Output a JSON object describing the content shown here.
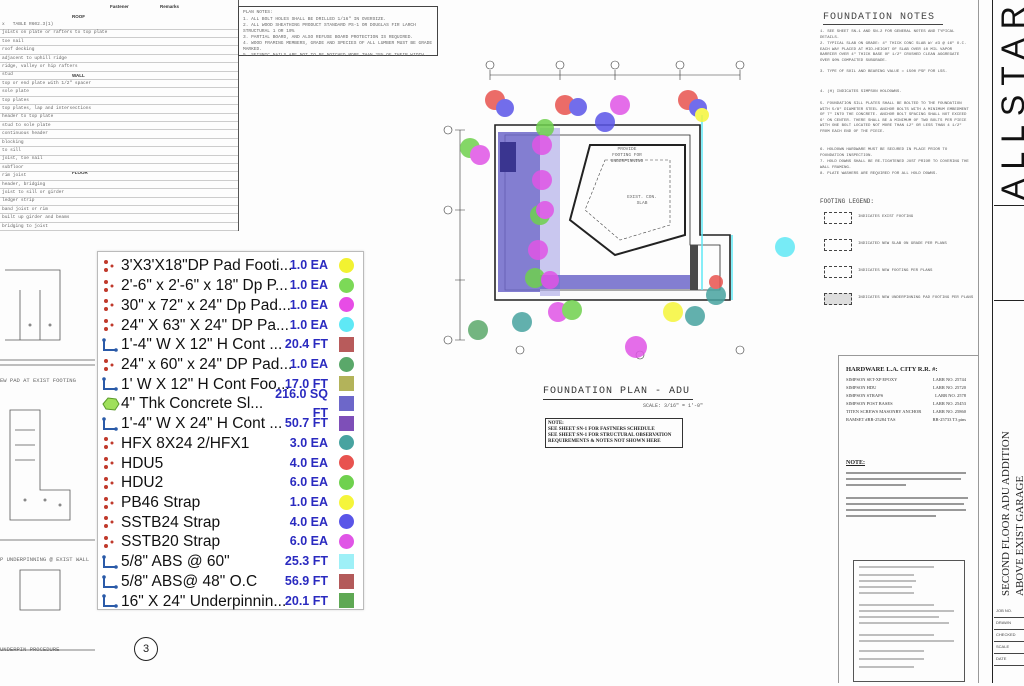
{
  "schedule": {
    "col_a": "Fastener",
    "col_b": "Remarks",
    "section_roof": "ROOF",
    "section_wall": "WALL",
    "section_floor": "FLOOR",
    "rows": [
      "x   TABLE R602.3(1)",
      "joists on plate or rafters to top plate",
      "toe nail",
      "roof decking",
      "adjacent to uphill ridge",
      "ridge, valley or hip rafters",
      "stud",
      "top or end plate with 1/2\" spacer",
      "sole plate",
      "top plates",
      "top plates, lap and intersections",
      "header to top plate",
      "stud to sole plate",
      "continuous header",
      "blocking",
      "to sill",
      "joist, toe nail",
      "subfloor",
      "rim joist",
      "header, bridging",
      "joist to sill or girder",
      "ledger strip",
      "band joist or rim",
      "built up girder and beams",
      "bridging to joist"
    ]
  },
  "plan_notes": {
    "title": "PLAN NOTES:",
    "lines": [
      "1. ALL BOLT HOLES SHALL BE DRILLED 1/16\" IN OVERSIZE.",
      "2. ALL WOOD SHEATHING PRODUCT STANDARD PS-1 OR DOUGLAS FIR LARCH STRUCTURAL 1 OR 10%",
      "3. PARTIAL BOARD, AND ALSO REFUSE BOARD PROTECTION IS REQUIRED.",
      "4. WOOD FRAMING MEMBERS, GRADE AND SPECIES OF ALL LUMBER MUST BE GRADE MARKED.",
      "5. SEISMIC NAILS ARE NOT TO BE NOTCHED MORE THAN 25% OF THEIR WIDTH."
    ]
  },
  "takeoff": {
    "items": [
      {
        "name": "3'X3'X18\"DP Pad Footi...",
        "qty": "1.0 EA",
        "icon": "count-dots-icon",
        "color": "#f2f231",
        "shape": "circle"
      },
      {
        "name": "2'-6\" x 2'-6\" x 18\" Dp P...",
        "qty": "1.0 EA",
        "icon": "count-dots-icon",
        "color": "#7cd957",
        "shape": "circle"
      },
      {
        "name": "30\" x 72\" x 24\" Dp Pad...",
        "qty": "1.0 EA",
        "icon": "count-dots-icon",
        "color": "#e74ce6",
        "shape": "circle"
      },
      {
        "name": "24\" X 63\" X 24\" DP Pa...",
        "qty": "1.0 EA",
        "icon": "count-dots-icon",
        "color": "#5fe8f5",
        "shape": "circle"
      },
      {
        "name": "1'-4\" W X 12\" H Cont ...",
        "qty": "20.4 FT",
        "icon": "linear-measure-icon",
        "color": "#b85b5b",
        "shape": "square"
      },
      {
        "name": "24\" x 60\" x 24\" DP Pad...",
        "qty": "1.0 EA",
        "icon": "count-dots-icon",
        "color": "#5aa86a",
        "shape": "circle"
      },
      {
        "name": "1' W X 12\" H Cont Foo...",
        "qty": "17.0 FT",
        "icon": "linear-measure-icon",
        "color": "#b3b35a",
        "shape": "square"
      },
      {
        "name": "4\" Thk Concrete Sl...",
        "qty": "216.0 SQ FT",
        "icon": "area-measure-icon",
        "color": "#6d67c9",
        "shape": "square"
      },
      {
        "name": "1'-4\" W X 24\" H Cont ...",
        "qty": "50.7 FT",
        "icon": "linear-measure-icon",
        "color": "#7e4fb8",
        "shape": "square"
      },
      {
        "name": "HFX 8X24 2/HFX1",
        "qty": "3.0 EA",
        "icon": "count-dots-icon",
        "color": "#48a3a0",
        "shape": "circle"
      },
      {
        "name": "HDU5",
        "qty": "4.0 EA",
        "icon": "count-dots-icon",
        "color": "#e8534f",
        "shape": "circle"
      },
      {
        "name": "HDU2",
        "qty": "6.0 EA",
        "icon": "count-dots-icon",
        "color": "#6fd14e",
        "shape": "circle"
      },
      {
        "name": "PB46 Strap",
        "qty": "1.0 EA",
        "icon": "count-dots-icon",
        "color": "#f5f53a",
        "shape": "circle"
      },
      {
        "name": "SSTB24 Strap",
        "qty": "4.0 EA",
        "icon": "count-dots-icon",
        "color": "#5a55e8",
        "shape": "circle"
      },
      {
        "name": "SSTB20 Strap",
        "qty": "6.0 EA",
        "icon": "count-dots-icon",
        "color": "#e055e6",
        "shape": "circle"
      },
      {
        "name": "5/8\" ABS @ 60\"",
        "qty": "25.3 FT",
        "icon": "linear-measure-icon",
        "color": "#9ef0f7",
        "shape": "square"
      },
      {
        "name": "5/8\" ABS@ 48\" O.C",
        "qty": "56.9 FT",
        "icon": "linear-measure-icon",
        "color": "#b35a5a",
        "shape": "square"
      },
      {
        "name": "16\" X 24\" Underpinnin...",
        "qty": "20.1 FT",
        "icon": "linear-measure-icon",
        "color": "#5fa854",
        "shape": "square"
      }
    ],
    "page_number": "3"
  },
  "left_details": {
    "label_pad": "EW PAD AT EXIST FOOTING",
    "label_underpin": "P UNDERPINNING @ EXIST WALL",
    "label_procedure": "UNDERPIN PROCEDURE"
  },
  "plan": {
    "title": "FOUNDATION PLAN - ADU",
    "scale": "SCALE: 3/16\" = 1'-0\"",
    "note_title": "NOTE:",
    "note_lines": [
      "SEE SHEET SN-1 FOR FASTNERS SCHEDULE",
      "SEE SHEET SN-1 FOR STRUCTURAL OBSERVATION",
      "REQUIREMENTS & NOTES NOT SHOWN HERE"
    ],
    "label_provide": "PROVIDE FOOTING FOR UNDERPINNING",
    "label_exist": "EXIST. CON. SLAB"
  },
  "foundation_notes": {
    "title": "FOUNDATION NOTES",
    "notes": [
      "1. SEE SHEET SN-1 AND SN-2 FOR GENERAL NOTES AND TYPICAL DETAILS.",
      "2. TYPICAL SLAB ON GRADE: 4\" THICK CONC SLAB W/ #3 @ 16\" O.C. EACH WAY PLACED AT MID-HEIGHT OF SLAB OVER 10 MIL VAPOR BARRIER OVER 4\" THICK BASE OF 1/2\" CRUSHED CLEAN AGGREGATE OVER 90% COMPACTED SUBGRADE.",
      "3. TYPE OF SOIL AND BEARING VALUE = 1500 PSF FOR LSS.",
      "4. (H) INDICATES SIMPSON HOLDOWNS.",
      "5. FOUNDATION SILL PLATES SHALL BE BOLTED TO THE FOUNDATION WITH 5/8\" DIAMETER STEEL ANCHOR BOLTS WITH A MINIMUM EMBEDMENT OF 7\" INTO THE CONCRETE. ANCHOR BOLT SPACING SHALL NOT EXCEED 6' ON CENTER. THERE SHALL BE A MINIMUM OF TWO BOLTS PER PIECE WITH ONE BOLT LOCATED NOT MORE THAN 12\" OR LESS THAN 4 1/2\" FROM EACH END OF THE PIECE.",
      "6. HOLDOWN HARDWARE MUST BE SECURED IN PLACE PRIOR TO FOUNDATION INSPECTION.",
      "7. HOLD DOWNS SHALL BE RE-TIGHTENED JUST PRIOR TO COVERING THE WALL FRAMING.",
      "8. PLATE WASHERS ARE REQUIRED FOR ALL HOLD DOWNS."
    ]
  },
  "footing_legend": {
    "title": "FOOTING LEGEND:",
    "items": [
      "INDICATES EXIST FOOTING",
      "INDICATED NEW SLAB ON GRADE PER PLANS",
      "INDICATES NEW FOOTING PER PLANS",
      "INDICATES NEW UNDERPINNING PAD FOOTING PER PLANS"
    ]
  },
  "hardware": {
    "title": "HARDWARE L.A. CITY R.R. #:",
    "rows": [
      {
        "label": "SIMPSON SET-XP EPOXY",
        "value": "LARR NO. 25744"
      },
      {
        "label": "SIMPSON HDU",
        "value": "LARR NO. 25720"
      },
      {
        "label": "SIMPSON STRAPS",
        "value": "LARR NO. 2578"
      },
      {
        "label": "SIMPSON POST BASES",
        "value": "LARR NO. 25453"
      },
      {
        "label": "TITEN SCREWS MASONRY ANCHOR",
        "value": "LARR NO. 25860"
      },
      {
        "label": "RAMSET #RR-25284 TAS",
        "value": "RR-25733 T3 pins"
      }
    ],
    "note_title": "NOTE:"
  },
  "title_block": {
    "brand": "ALLSTAR",
    "project_line1": "SECOND FLOOR ADU ADDITION",
    "project_line2": "ABOVE EXIST GARAGE",
    "cells": [
      "JOB NO.",
      "DRAWN",
      "CHECKED",
      "SCALE",
      "DATE"
    ]
  }
}
